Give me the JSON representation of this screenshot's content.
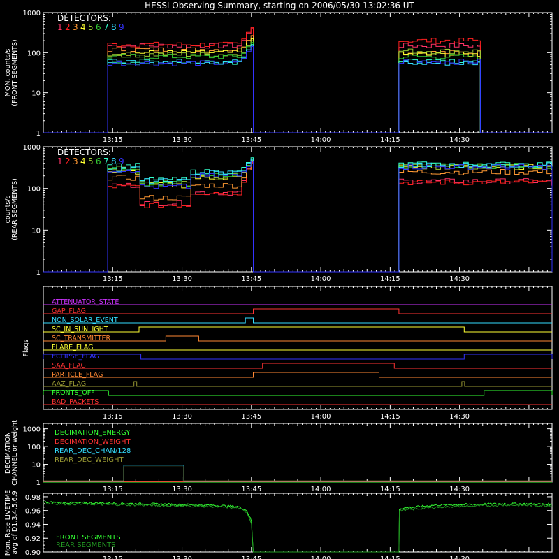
{
  "title": "HESSI Observing Summary, starting on 2006/05/30 13:02:36 UT",
  "colors": {
    "axis": "#ffffff",
    "det": [
      "#ff3366",
      "#ff2020",
      "#ff9933",
      "#ffff33",
      "#99cc33",
      "#33cc33",
      "#33ffcc",
      "#33ddff",
      "#3333ff"
    ]
  },
  "time_ticks": [
    "13:15",
    "13:30",
    "13:45",
    "14:00",
    "14:15",
    "14:30"
  ],
  "chart_data": [
    {
      "type": "line",
      "panel": "front",
      "ylabel": [
        "MON. counts/s",
        "(FRONT SEGMENTS)"
      ],
      "yscale": "log",
      "ylim": [
        1,
        1000
      ],
      "ytick_labels": [
        "1",
        "10",
        "100",
        "1000"
      ],
      "legend_title": "DETECTORS:",
      "detectors": [
        "1",
        "2",
        "3",
        "4",
        "5",
        "6",
        "7",
        "8",
        "9"
      ],
      "x_unit": "minutes after 13:00 UT",
      "segments": [
        {
          "start": 13.9,
          "end": 45.4,
          "levels": [
            150,
            160,
            120,
            100,
            90,
            80,
            60,
            60,
            55
          ],
          "final_peak": [
            450,
            480,
            300,
            250,
            220,
            200,
            180,
            170,
            160
          ]
        },
        {
          "start": 76.9,
          "end": 94.5,
          "levels": [
            150,
            200,
            100,
            90,
            110,
            80,
            60,
            55,
            60
          ]
        }
      ]
    },
    {
      "type": "line",
      "panel": "rear",
      "ylabel": [
        "counts/s",
        "(REAR SEGMENTS)"
      ],
      "yscale": "log",
      "ylim": [
        1,
        1000
      ],
      "ytick_labels": [
        "1",
        "10",
        "100",
        "1000"
      ],
      "legend_title": "DETECTORS:",
      "detectors": [
        "1",
        "2",
        "3",
        "4",
        "5",
        "6",
        "7",
        "8",
        "9"
      ],
      "x_unit": "minutes after 13:00 UT",
      "segments": [
        {
          "start": 13.9,
          "end": 45.4,
          "phases": [
            {
              "until": 20.7,
              "levels": [
                120,
                110,
                180,
                250,
                300,
                280,
                350,
                300,
                280
              ]
            },
            {
              "until": 31.3,
              "levels": [
                45,
                40,
                60,
                120,
                140,
                130,
                160,
                150,
                110
              ]
            },
            {
              "until": 45.4,
              "levels": [
                80,
                80,
                120,
                180,
                200,
                210,
                250,
                240,
                200
              ]
            }
          ],
          "final_peak": [
            500,
            480,
            450,
            500,
            520,
            530,
            600,
            550,
            500
          ]
        },
        {
          "start": 76.9,
          "end": 110,
          "levels": [
            150,
            140,
            250,
            330,
            330,
            350,
            380,
            360,
            330
          ]
        }
      ]
    },
    {
      "type": "line",
      "panel": "flags",
      "ylabel": "Flags",
      "flags": [
        {
          "name": "ATTENUATOR_STATE",
          "color": "#cc33ff",
          "on": []
        },
        {
          "name": "GAP_FLAG",
          "color": "#ff3333",
          "on": [
            [
              45.4,
              76.9
            ]
          ]
        },
        {
          "name": "NON_SOLAR_EVENT",
          "color": "#33ddff",
          "on": [
            [
              43.7,
              45.4
            ]
          ]
        },
        {
          "name": "SC_IN_SUNLIGHT",
          "color": "#ffff33",
          "on": [
            [
              20.7,
              91
            ]
          ]
        },
        {
          "name": "SC_TRANSMITTER",
          "color": "#ff8833",
          "on": [
            [
              26.5,
              33.6
            ]
          ]
        },
        {
          "name": "FLARE_FLAG",
          "color": "#ffff33",
          "on": []
        },
        {
          "name": "ECLIPSE_FLAG",
          "color": "#3333ff",
          "on": [
            [
              0,
              21.1
            ],
            [
              91,
              110
            ]
          ]
        },
        {
          "name": "SAA_FLAG",
          "color": "#ff3333",
          "on": [
            [
              47.4,
              75.9
            ]
          ]
        },
        {
          "name": "PARTICLE_FLAG",
          "color": "#ff8833",
          "on": [
            [
              45.4,
              72.6
            ]
          ]
        },
        {
          "name": "AAZ_FLAG",
          "color": "#999933",
          "on": [
            [
              19.6,
              20.2
            ],
            [
              90.5,
              91.1
            ]
          ]
        },
        {
          "name": "FRONTS_OFF",
          "color": "#33ff33",
          "on": [
            [
              0,
              14.1
            ],
            [
              95.3,
              110
            ]
          ]
        },
        {
          "name": "BAD_PACKETS",
          "color": "#ff3333",
          "on": []
        }
      ]
    },
    {
      "type": "line",
      "panel": "decimation",
      "ylabel": [
        "DECIMATION",
        "CHANNEL or weight"
      ],
      "yscale": "log",
      "ylim": [
        1,
        2000
      ],
      "ytick_labels": [
        "1",
        "10",
        "100",
        "1000"
      ],
      "series": [
        {
          "name": "DECIMATION_ENERGY",
          "color": "#33ff33",
          "values": [
            [
              0,
              1
            ],
            [
              110,
              1
            ]
          ]
        },
        {
          "name": "DECIMATION_WEIGHT",
          "color": "#ff3333",
          "values": [
            [
              0,
              1
            ],
            [
              110,
              1
            ]
          ]
        },
        {
          "name": "REAR_DEC_CHAN/128",
          "color": "#33ddff",
          "values": [
            [
              0,
              1
            ],
            [
              17.4,
              1
            ],
            [
              17.4,
              8
            ],
            [
              30.4,
              8
            ],
            [
              30.4,
              1
            ],
            [
              110,
              1
            ]
          ]
        },
        {
          "name": "REAR_DEC_WEIGHT",
          "color": "#999933",
          "values": [
            [
              0,
              1
            ],
            [
              17.4,
              1
            ],
            [
              17.4,
              6
            ],
            [
              30.4,
              6
            ],
            [
              30.4,
              1
            ],
            [
              110,
              1
            ]
          ]
        }
      ]
    },
    {
      "type": "line",
      "panel": "livetime",
      "ylabel": [
        "Mon. Rate LIVETIME",
        "avg of D1,3,4,5,6,9"
      ],
      "ylim": [
        0.9,
        0.985
      ],
      "ytick_labels": [
        "0.90",
        "0.92",
        "0.94",
        "0.96",
        "0.98"
      ],
      "series": [
        {
          "name": "FRONT SEGMENTS",
          "color": "#33ff33",
          "values": [
            [
              0,
              0.972
            ],
            [
              20,
              0.97
            ],
            [
              35,
              0.968
            ],
            [
              42,
              0.966
            ],
            [
              44,
              0.96
            ],
            [
              45,
              0.945
            ],
            [
              45.4,
              0.9
            ],
            [
              76.9,
              0.9
            ],
            [
              77,
              0.963
            ],
            [
              85,
              0.968
            ],
            [
              100,
              0.97
            ],
            [
              110,
              0.969
            ]
          ]
        },
        {
          "name": "REAR SEGMENTS",
          "color": "#229922",
          "values": [
            [
              0,
              0.97
            ],
            [
              20,
              0.968
            ],
            [
              35,
              0.966
            ],
            [
              42,
              0.964
            ],
            [
              44,
              0.958
            ],
            [
              45,
              0.942
            ],
            [
              45.4,
              0.9
            ],
            [
              76.9,
              0.9
            ],
            [
              77,
              0.96
            ],
            [
              85,
              0.965
            ],
            [
              100,
              0.968
            ],
            [
              110,
              0.967
            ]
          ]
        }
      ]
    }
  ]
}
